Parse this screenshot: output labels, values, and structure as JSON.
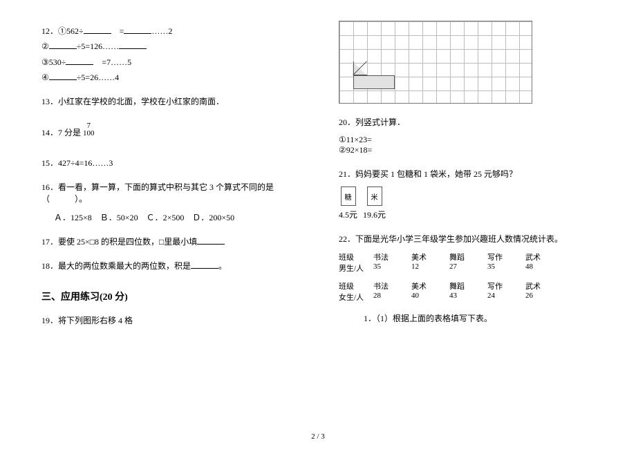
{
  "left": {
    "q12": {
      "label": "12．",
      "p1a": "①562÷",
      "p1b": "=",
      "p1c": "……2",
      "p2a": "②",
      "p2b": "÷5=126……",
      "p3a": "③530÷",
      "p3b": "=7……5",
      "p4a": "④",
      "p4b": "÷5=26……4"
    },
    "q13": {
      "label": "13．",
      "text": "小红家在学校的北面，学校在小红家的南面．"
    },
    "q14": {
      "label": "14．",
      "text": "7 分是",
      "frac_num": "7",
      "frac_den": "100"
    },
    "q15": {
      "label": "15．",
      "text": "427÷4=16……3"
    },
    "q16": {
      "label": "16．",
      "text": "看一看，算一算，下面的算式中积与其它 3 个算式不同的是（　　　）。",
      "optA": "Ａ．125×8",
      "optB": "Ｂ．50×20",
      "optC": "Ｃ．2×500",
      "optD": "Ｄ．200×50"
    },
    "q17": {
      "label": "17．",
      "text1": "要使 25×□8 的积是四位数，□里最小填"
    },
    "q18": {
      "label": "18．",
      "text1": "最大的两位数乘最大的两位数，积是",
      "text2": "。"
    },
    "section3": "三、应用练习(20 分)",
    "q19": {
      "label": "19．",
      "text": "将下列图形右移 4 格"
    }
  },
  "right": {
    "q20": {
      "label": "20．",
      "text": "列竖式计算．",
      "a": "①11×23=",
      "b": "②92×18="
    },
    "q21": {
      "label": "21．",
      "text": "妈妈要买 1 包糖和 1 袋米，她带 25 元够吗？",
      "sugar_char": "糖",
      "rice_char": "米",
      "sugar_price": "4.5元",
      "rice_price": "19.6元"
    },
    "q22": {
      "label": "22．",
      "text": "下面是光华小学三年级学生参加兴趣班人数情况统计表。",
      "hd_class": "班级",
      "hd_boys": "男生/人",
      "hd_girls": "女生/人",
      "cols": [
        "书法",
        "美术",
        "舞蹈",
        "写作",
        "武术"
      ],
      "boys": [
        "35",
        "12",
        "27",
        "35",
        "48"
      ],
      "girls": [
        "28",
        "40",
        "43",
        "24",
        "26"
      ],
      "sub1": "1．（1）根据上面的表格填写下表。"
    }
  },
  "footer": "2 / 3"
}
